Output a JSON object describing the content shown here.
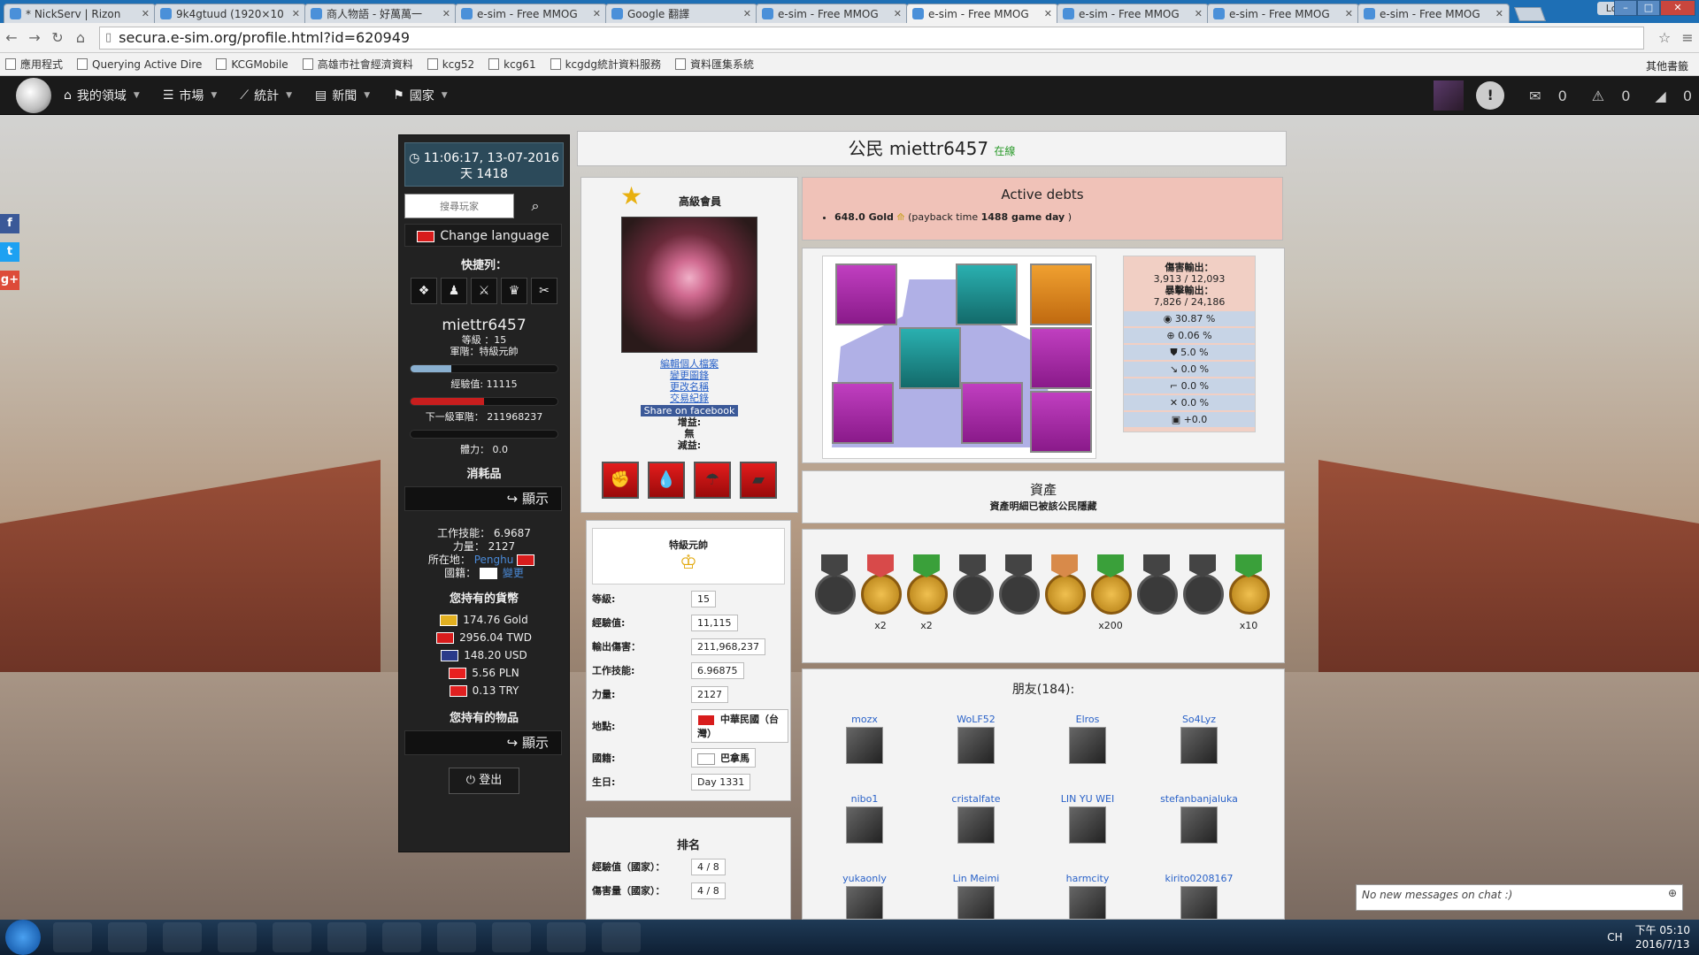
{
  "browser": {
    "tabs": [
      {
        "label": "* NickServ | Rizon"
      },
      {
        "label": "9k4gtuud (1920×10"
      },
      {
        "label": "商人物語 - 好萬萬一"
      },
      {
        "label": "e-sim - Free MMOG"
      },
      {
        "label": "Google 翻譯"
      },
      {
        "label": "e-sim - Free MMOG"
      },
      {
        "label": "e-sim - Free MMOG"
      },
      {
        "label": "e-sim - Free MMOG"
      },
      {
        "label": "e-sim - Free MMOG"
      },
      {
        "label": "e-sim - Free MMOG"
      }
    ],
    "profile_chip": "Locy",
    "url": "secura.e-sim.org/profile.html?id=620949",
    "bookmarks": [
      "應用程式",
      "Querying Active Dire",
      "KCGMobile",
      "高雄市社會經濟資料",
      "kcg52",
      "kcg61",
      "kcgdg統計資料服務",
      "資料匯集系統"
    ],
    "other_bookmarks": "其他書籤"
  },
  "game_nav": {
    "items": [
      {
        "label": "我的領域",
        "icon": "home-icon"
      },
      {
        "label": "市場",
        "icon": "market-icon"
      },
      {
        "label": "統計",
        "icon": "chart-icon"
      },
      {
        "label": "新聞",
        "icon": "news-icon"
      },
      {
        "label": "國家",
        "icon": "flag-icon"
      }
    ],
    "messages": "0",
    "alerts": "0",
    "feed": "0"
  },
  "sidebar": {
    "time": "11:06:17, 13-07-2016",
    "day": "天 1418",
    "search_placeholder": "搜尋玩家",
    "change_language": "Change language",
    "quickbar_title": "快捷列：",
    "player_name": "miettr6457",
    "level_line": "等級 ：15",
    "rank_line": "軍階：特級元帥",
    "xp_label": "經驗值: 11115",
    "next_rank_label": "下一級軍階： 211968237",
    "xp_progress": 0.28,
    "rank_progress": 0.5,
    "stamina_progress": 0,
    "stamina_label": "體力： 0.0",
    "consumables_title": "消耗品",
    "show_label": "顯示",
    "work_skill": "工作技能： 6.9687",
    "strength": "力量： 2127",
    "location_label": "所在地：",
    "location": "Penghu",
    "citizenship_label": "國籍：",
    "citizenship_change": "變更",
    "currency_title": "您持有的貨幣",
    "currencies": [
      {
        "amount": "174.76 Gold",
        "color": "#e2b020"
      },
      {
        "amount": "2956.04 TWD",
        "color": "#d81c1c"
      },
      {
        "amount": "148.20 USD",
        "color": "#2a3a8a"
      },
      {
        "amount": "5.56 PLN",
        "color": "#e82020"
      },
      {
        "amount": "0.13 TRY",
        "color": "#e02020"
      }
    ],
    "items_title": "您持有的物品",
    "logout": "登出"
  },
  "profile": {
    "title": "公民 miettr6457",
    "online": "在線",
    "membership": "高級會員",
    "links": [
      "編輯個人檔案",
      "變更圖鋒",
      "更改名稱",
      "交易紀錄"
    ],
    "share": "Share on facebook",
    "buff_label": "增益:",
    "buff_value": "無",
    "debuff_label": "減益:"
  },
  "debts": {
    "title": "Active debts",
    "amount": "648.0 Gold",
    "note_prefix": "(payback time ",
    "game_days": "1488 game day",
    "note_suffix": " )"
  },
  "stats": {
    "damage_label": "傷害輸出：",
    "damage": "3,913 / 12,093",
    "crit_label": "暴擊輸出：",
    "crit": "7,826 / 24,186",
    "rows": [
      "30.87 %",
      "0.06 %",
      "5.0 %",
      "0.0 %",
      "0.0 %",
      "0.0 %",
      "+0.0"
    ]
  },
  "assets": {
    "title": "資產",
    "subtitle": "資產明細已被該公民隱藏"
  },
  "medals": {
    "counts": [
      "",
      "x2",
      "x2",
      "",
      "",
      "",
      "x200",
      "",
      "",
      "x10"
    ]
  },
  "friends": {
    "title": "朋友(184):",
    "list": [
      {
        "name": "mozx"
      },
      {
        "name": "WoLF52"
      },
      {
        "name": "Elros"
      },
      {
        "name": "So4Lyz"
      },
      {
        "name": "nibo1"
      },
      {
        "name": "cristalfate"
      },
      {
        "name": "LIN YU WEI"
      },
      {
        "name": "stefanbanjaluka"
      },
      {
        "name": "yukaonly"
      },
      {
        "name": "Lin Meimi"
      },
      {
        "name": "harmcity"
      },
      {
        "name": "kirito0208167"
      }
    ]
  },
  "rank_card": {
    "rank_name": "特級元帥",
    "fields": [
      {
        "label": "等級:",
        "value": "15"
      },
      {
        "label": "經驗值:",
        "value": "11,115"
      },
      {
        "label": "輸出傷害：",
        "value": "211,968,237"
      },
      {
        "label": "工作技能:",
        "value": "6.96875"
      },
      {
        "label": "力量:",
        "value": "2127"
      },
      {
        "label": "地點:",
        "value": "中華民國（台灣）"
      },
      {
        "label": "國籍:",
        "value": "巴拿馬"
      },
      {
        "label": "生日:",
        "value": "Day 1331"
      }
    ]
  },
  "ranking": {
    "title": "排名",
    "rows": [
      {
        "label": "經驗值（國家）：",
        "value": "4 / 8"
      },
      {
        "label": "傷害量（國家）：",
        "value": "4 / 8"
      }
    ]
  },
  "chat": {
    "text": "No new messages on chat :)"
  },
  "tray": {
    "lang": "CH",
    "time": "下午 05:10",
    "date": "2016/7/13"
  }
}
